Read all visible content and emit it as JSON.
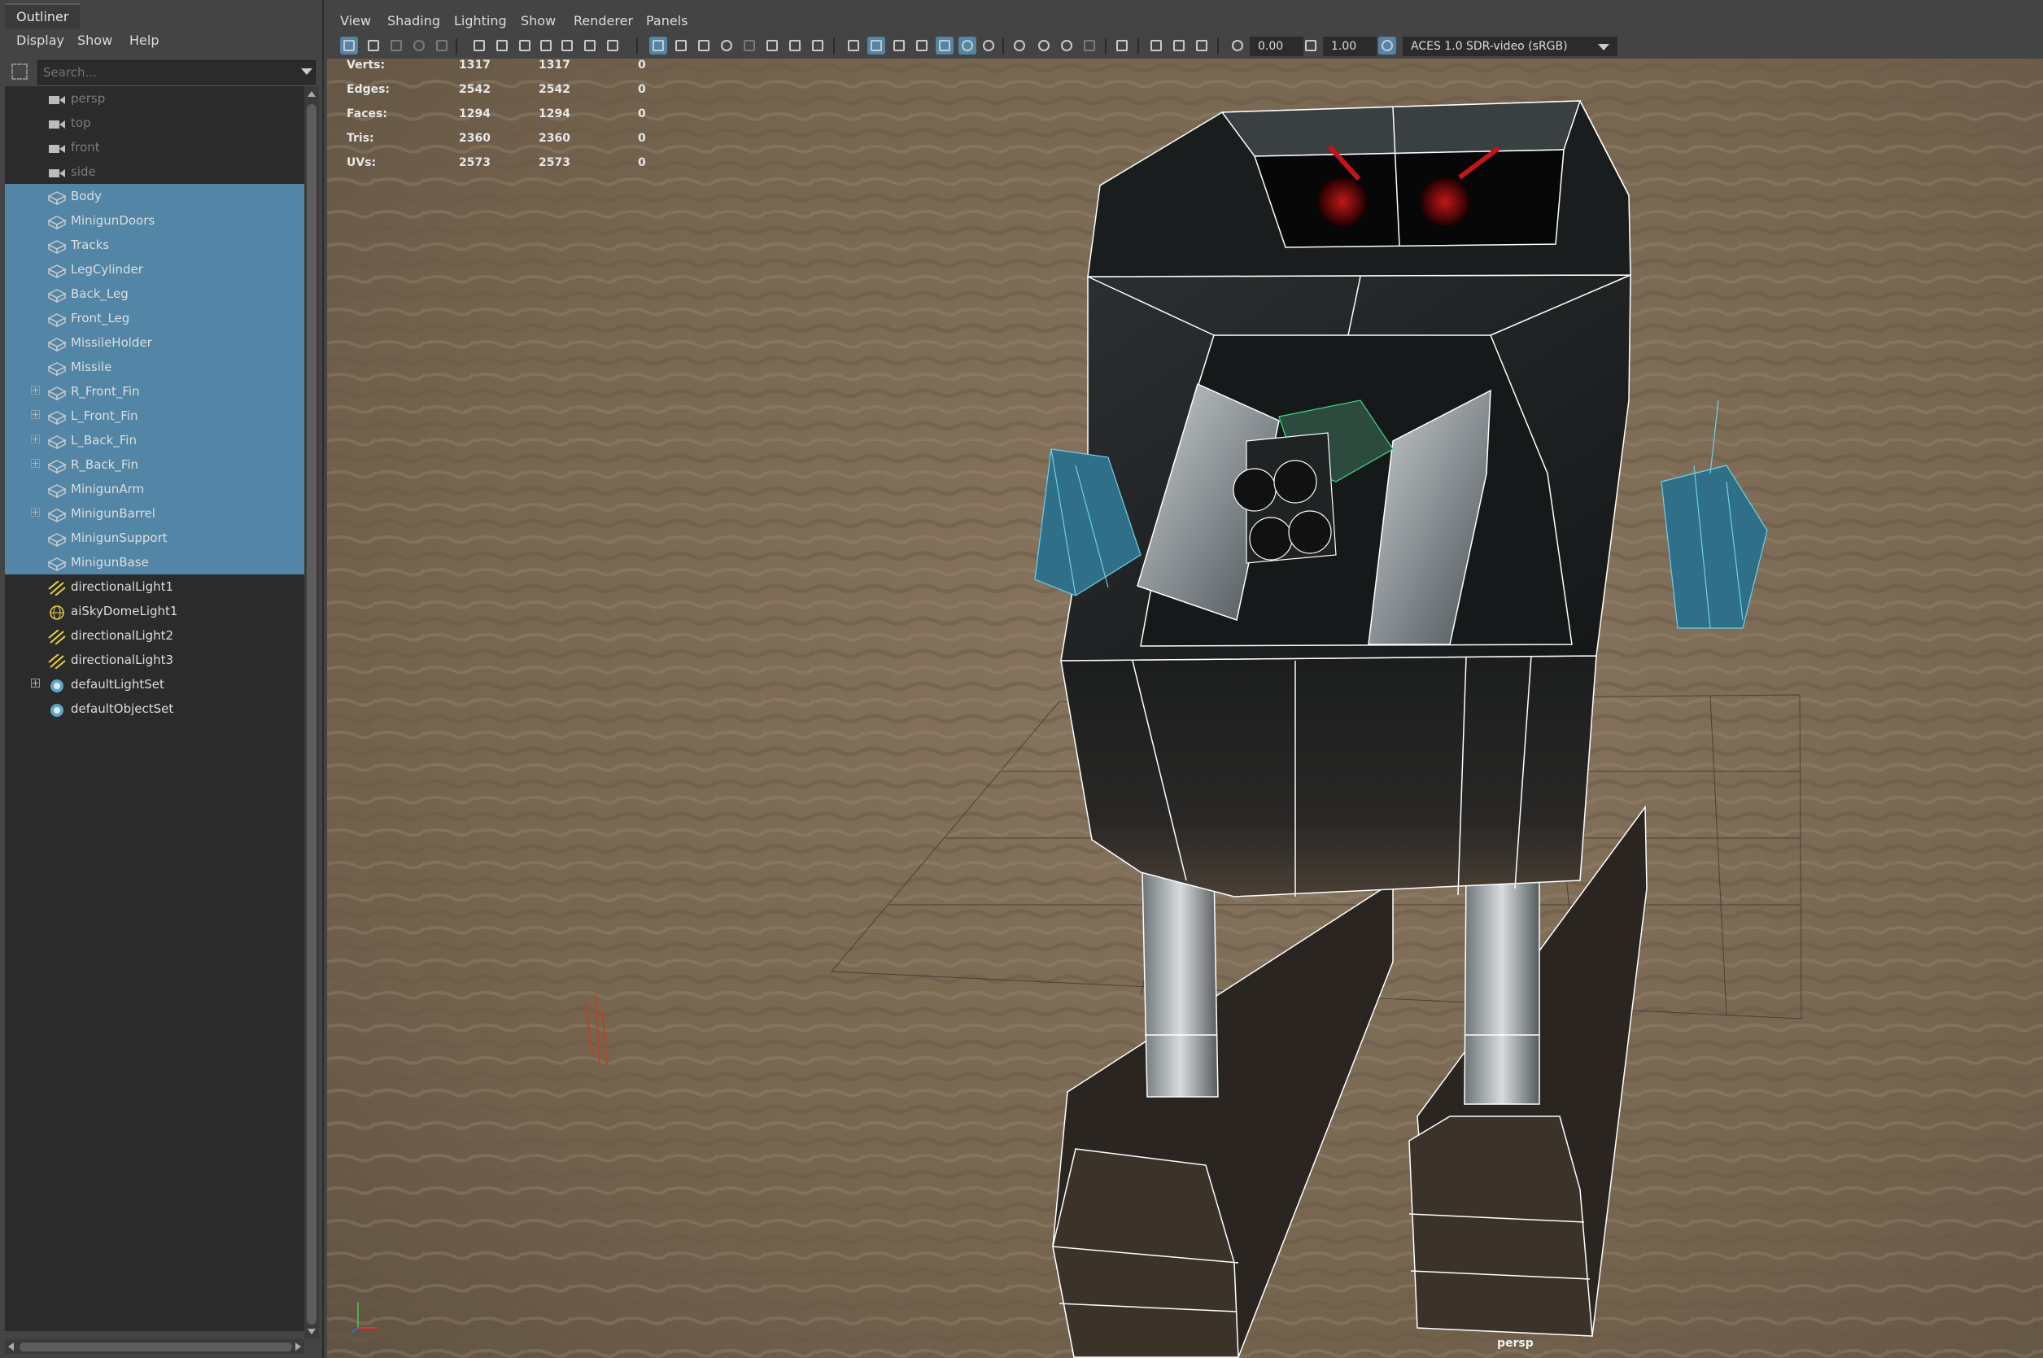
{
  "outliner": {
    "tab_title": "Outliner",
    "menu": [
      "Display",
      "Show",
      "Help"
    ],
    "search_placeholder": "Search...",
    "items": [
      {
        "label": "persp",
        "icon": "camera-icon",
        "selected": false,
        "dim": true,
        "expandable": false
      },
      {
        "label": "top",
        "icon": "camera-icon",
        "selected": false,
        "dim": true,
        "expandable": false
      },
      {
        "label": "front",
        "icon": "camera-icon",
        "selected": false,
        "dim": true,
        "expandable": false
      },
      {
        "label": "side",
        "icon": "camera-icon",
        "selected": false,
        "dim": true,
        "expandable": false
      },
      {
        "label": "Body",
        "icon": "mesh-icon",
        "selected": true,
        "dim": false,
        "expandable": false
      },
      {
        "label": "MinigunDoors",
        "icon": "mesh-icon",
        "selected": true,
        "dim": false,
        "expandable": false
      },
      {
        "label": "Tracks",
        "icon": "mesh-icon",
        "selected": true,
        "dim": false,
        "expandable": false
      },
      {
        "label": "LegCylinder",
        "icon": "mesh-icon",
        "selected": true,
        "dim": false,
        "expandable": false
      },
      {
        "label": "Back_Leg",
        "icon": "mesh-icon",
        "selected": true,
        "dim": false,
        "expandable": false
      },
      {
        "label": "Front_Leg",
        "icon": "mesh-icon",
        "selected": true,
        "dim": false,
        "expandable": false
      },
      {
        "label": "MissileHolder",
        "icon": "mesh-icon",
        "selected": true,
        "dim": false,
        "expandable": false
      },
      {
        "label": "Missile",
        "icon": "mesh-icon",
        "selected": true,
        "dim": false,
        "expandable": false
      },
      {
        "label": "R_Front_Fin",
        "icon": "mesh-icon",
        "selected": true,
        "dim": false,
        "expandable": true
      },
      {
        "label": "L_Front_Fin",
        "icon": "mesh-icon",
        "selected": true,
        "dim": false,
        "expandable": true
      },
      {
        "label": "L_Back_Fin",
        "icon": "mesh-icon",
        "selected": true,
        "dim": false,
        "expandable": true
      },
      {
        "label": "R_Back_Fin",
        "icon": "mesh-icon",
        "selected": true,
        "dim": false,
        "expandable": true
      },
      {
        "label": "MinigunArm",
        "icon": "mesh-icon",
        "selected": true,
        "dim": false,
        "expandable": false
      },
      {
        "label": "MinigunBarrel",
        "icon": "mesh-icon",
        "selected": true,
        "dim": false,
        "expandable": true
      },
      {
        "label": "MinigunSupport",
        "icon": "mesh-icon",
        "selected": true,
        "dim": false,
        "expandable": false
      },
      {
        "label": "MinigunBase",
        "icon": "mesh-icon",
        "selected": true,
        "dim": false,
        "expandable": false
      },
      {
        "label": "directionalLight1",
        "icon": "directional-light-icon",
        "selected": false,
        "dim": false,
        "expandable": false
      },
      {
        "label": "aiSkyDomeLight1",
        "icon": "skydome-light-icon",
        "selected": false,
        "dim": false,
        "expandable": false
      },
      {
        "label": "directionalLight2",
        "icon": "directional-light-icon",
        "selected": false,
        "dim": false,
        "expandable": false
      },
      {
        "label": "directionalLight3",
        "icon": "directional-light-icon",
        "selected": false,
        "dim": false,
        "expandable": false
      },
      {
        "label": "defaultLightSet",
        "icon": "set-icon",
        "selected": false,
        "dim": false,
        "expandable": true
      },
      {
        "label": "defaultObjectSet",
        "icon": "set-icon",
        "selected": false,
        "dim": false,
        "expandable": false
      }
    ]
  },
  "viewport": {
    "menu": [
      "View",
      "Shading",
      "Lighting",
      "Show",
      "Renderer",
      "Panels"
    ],
    "exposure_value": "0.00",
    "gamma_value": "1.00",
    "color_space": "ACES 1.0 SDR-video (sRGB)",
    "camera_label": "persp",
    "hud": [
      {
        "label": "Verts:",
        "a": "1317",
        "b": "1317",
        "c": "0"
      },
      {
        "label": "Edges:",
        "a": "2542",
        "b": "2542",
        "c": "0"
      },
      {
        "label": "Faces:",
        "a": "1294",
        "b": "1294",
        "c": "0"
      },
      {
        "label": "Tris:",
        "a": "2360",
        "b": "2360",
        "c": "0"
      },
      {
        "label": "UVs:",
        "a": "2573",
        "b": "2573",
        "c": "0"
      }
    ]
  },
  "colors": {
    "selection": "#5285a6",
    "panel_bg": "#444444",
    "tree_bg": "#2b2b2b",
    "wireframe_selected": "#ffffff",
    "wireframe_active": "#3ddc84",
    "missile_wire": "#6fd0e8",
    "ground": "#7b6a55"
  }
}
